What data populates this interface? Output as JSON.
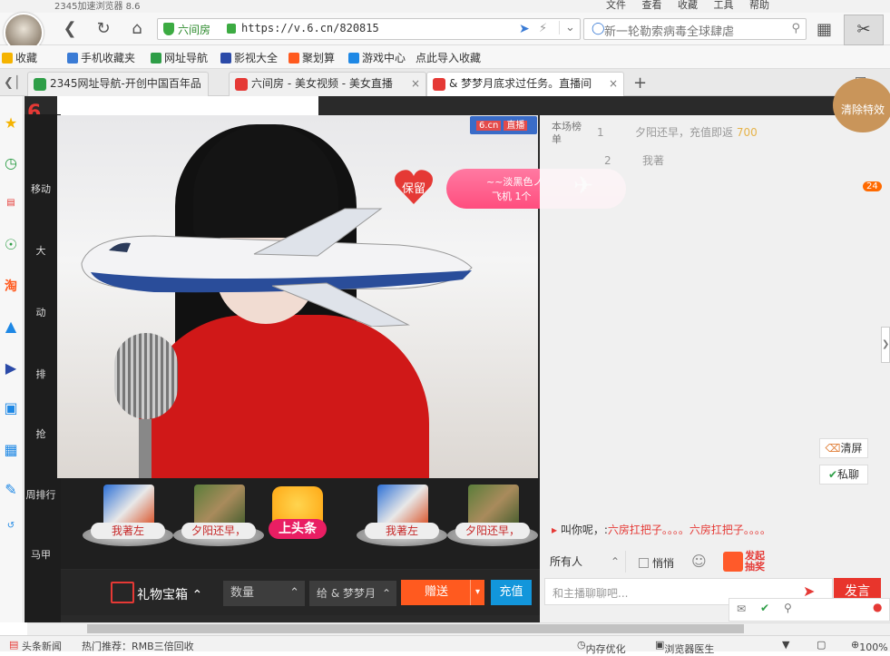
{
  "browser": {
    "title": "2345加速浏览器 8.6",
    "menus": [
      "文件",
      "查看",
      "收藏",
      "工具",
      "帮助"
    ],
    "url_site": "六间房",
    "url": "https://v.6.cn/820815",
    "search_placeholder": "新一轮勒索病毒全球肆虐",
    "favorites": [
      "收藏",
      "手机收藏夹",
      "网址导航",
      "影视大全",
      "聚划算",
      "游戏中心",
      "点此导入收藏"
    ],
    "tabs": [
      {
        "label": "2345网址导航-开创中国百年品"
      },
      {
        "label": "六间房 - 美女视频 - 美女直播"
      },
      {
        "label": "& 梦梦月底求过任务。直播间"
      }
    ]
  },
  "stream": {
    "brand_badge": "6.cn",
    "brand_live": "直播",
    "keep_label": "保留",
    "gift_banner": {
      "user": "~~淡黑色ノ",
      "gift": "飞机",
      "count": "1个"
    },
    "rank_label": "本场榜单",
    "rank_rows": [
      {
        "rank": "1",
        "name": "夕阳还早，充值即返",
        "value": "700"
      },
      {
        "rank": "2",
        "name": "我著",
        "value": ""
      }
    ],
    "badge_count": "24",
    "clear_effects": "清除特效",
    "clear_screen": "清屏",
    "private_chat": "私聊",
    "system_message": {
      "prefix": "叫你呢，:",
      "text": "六房扛把子。。。。六房扛把子。。。。"
    },
    "chat": {
      "target": "所有人",
      "whisper": "悄悄",
      "lottery": "发起抽奖",
      "input_placeholder": "和主播聊聊吧...",
      "send": "发言"
    },
    "gift_users": [
      {
        "name": "我著左"
      },
      {
        "name": "夕阳还早，"
      },
      {
        "name": "我著左"
      },
      {
        "name": "夕阳还早，"
      }
    ],
    "headline": "上头条",
    "bottom": {
      "giftbox": "礼物宝箱",
      "quantity": "数量",
      "to": "给 & 梦梦月",
      "give": "赠送",
      "recharge": "充值"
    }
  },
  "left_column": [
    "移动",
    "大",
    "动",
    "排",
    "抢",
    "周排行",
    "马甲"
  ],
  "status_bar": {
    "news": "头条新闻",
    "hot": "热门推荐：RMB三倍回收",
    "memory": "内存优化",
    "doctor": "浏览器医生",
    "zoom": "100%"
  }
}
